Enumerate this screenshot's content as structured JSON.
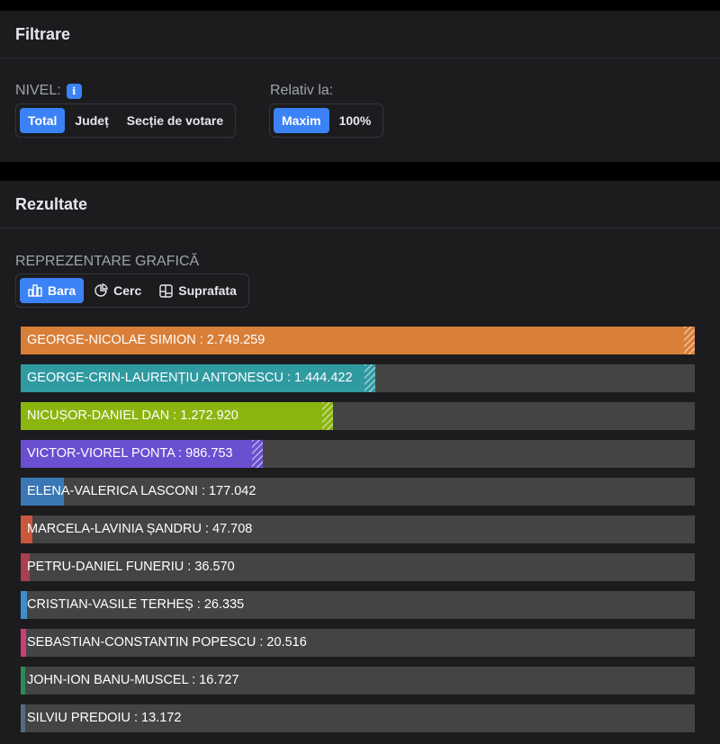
{
  "filter": {
    "title": "Filtrare",
    "level_label": "NIVEL:",
    "level_options": [
      "Total",
      "Județ",
      "Secție de votare"
    ],
    "level_selected": "Total",
    "relative_label": "Relativ la:",
    "relative_options": [
      "Maxim",
      "100%"
    ],
    "relative_selected": "Maxim"
  },
  "results": {
    "title": "Rezultate",
    "chart_mode_label": "REPREZENTARE GRAFICĂ",
    "chart_modes": [
      {
        "label": "Bara",
        "icon": "bar-chart-icon"
      },
      {
        "label": "Cerc",
        "icon": "pie-chart-icon"
      },
      {
        "label": "Suprafata",
        "icon": "treemap-icon"
      }
    ],
    "chart_mode_selected": "Bara"
  },
  "chart_data": {
    "type": "bar",
    "orientation": "horizontal",
    "max": 2749259,
    "categories": [
      "GEORGE-NICOLAE SIMION",
      "GEORGE-CRIN-LAURENȚIU ANTONESCU",
      "NICUȘOR-DANIEL DAN",
      "VICTOR-VIOREL PONTA",
      "ELENA-VALERICA LASCONI",
      "MARCELA-LAVINIA ȘANDRU",
      "PETRU-DANIEL FUNERIU",
      "CRISTIAN-VASILE TERHEȘ",
      "SEBASTIAN-CONSTANTIN POPESCU",
      "JOHN-ION BANU-MUSCEL",
      "SILVIU PREDOIU"
    ],
    "values": [
      2749259,
      1444422,
      1272920,
      986753,
      177042,
      47708,
      36570,
      26335,
      20516,
      16727,
      13172
    ],
    "value_labels": [
      "2.749.259",
      "1.444.422",
      "1.272.920",
      "986.753",
      "177.042",
      "47.708",
      "36.570",
      "26.335",
      "20.516",
      "16.727",
      "13.172"
    ],
    "colors": [
      "#d97f38",
      "#2f9aa0",
      "#8ab50f",
      "#6a4fd1",
      "#3a78b5",
      "#c9573b",
      "#a8404f",
      "#3b8ed0",
      "#cc3f76",
      "#2e8b57",
      "#566a82"
    ],
    "hatched": [
      true,
      true,
      true,
      true,
      false,
      false,
      false,
      false,
      false,
      false,
      false
    ]
  }
}
